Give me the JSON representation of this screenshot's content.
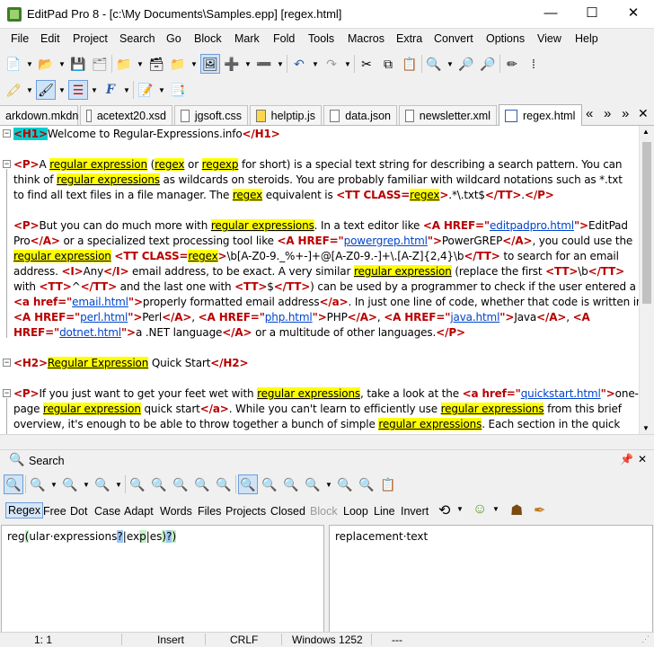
{
  "window": {
    "title": "EditPad Pro 8 - [c:\\My Documents\\Samples.epp] [regex.html]",
    "minimize": "—",
    "maximize": "☐",
    "close": "✕"
  },
  "menu": [
    "File",
    "Edit",
    "Project",
    "Search",
    "Go",
    "Block",
    "Mark",
    "Fold",
    "Tools",
    "Macros",
    "Extra",
    "Convert",
    "Options",
    "View",
    "Help"
  ],
  "tabs": [
    {
      "label": "arkdown.mkdn",
      "icon": "doc-icon"
    },
    {
      "label": "acetext20.xsd",
      "icon": "doc-icon"
    },
    {
      "label": "jgsoft.css",
      "icon": "css-icon"
    },
    {
      "label": "helptip.js",
      "icon": "js-icon"
    },
    {
      "label": "data.json",
      "icon": "doc-icon"
    },
    {
      "label": "newsletter.xml",
      "icon": "xml-icon"
    },
    {
      "label": "regex.html",
      "icon": "html-icon",
      "active": true
    }
  ],
  "tab_controls": [
    "«",
    "»",
    "»",
    "✕"
  ],
  "editor": {
    "l1_open": "<H1>",
    "l1_text": "Welcome to Regular-Expressions.info",
    "l1_close": "</H1>",
    "p1": {
      "a": "<P>",
      "b": "A ",
      "c": "regular expression",
      "d": " (",
      "e": "regex",
      "f": " or ",
      "g": "regexp",
      "h": " for short) is a special text string for describing a search pattern.  You can",
      "i": "think of ",
      "j": "regular expressions",
      "k": " as wildcards on steroids.  You are probably familiar with wildcard notations such as *.txt",
      "l": "to find all text files in a file manager.  The ",
      "m": "regex",
      "n": " equivalent is ",
      "o": "<TT CLASS=",
      "p": "regex",
      "q": ">",
      "r": ".*\\.txt$",
      "s": "</TT>",
      "t": ".",
      "u": "</P>"
    },
    "p2": [
      "<P>",
      "But you can do much more with ",
      "regular expressions",
      ".  In a text editor like ",
      "<A HREF=\"",
      "editpadpro.html",
      "\">",
      "EditPad",
      "Pro",
      "</A>",
      " or a specialized text processing tool like ",
      "<A HREF=\"",
      "powergrep.html",
      "\">",
      "PowerGREP",
      "</A>",
      ", you could use the",
      "regular expression",
      " ",
      "<TT CLASS=",
      "regex",
      ">",
      "\\b[A-Z0-9._%+-]+@[A-Z0-9.-]+\\.[A-Z]{2,4}\\b",
      "</TT>",
      " to search for an email",
      "address.  ",
      "<I>",
      "Any",
      "</I>",
      " email address, to be exact.  A very similar ",
      "regular expression",
      " (replace the first ",
      "<TT>",
      "\\b",
      "</TT>",
      "with ",
      "<TT>",
      "^",
      "</TT>",
      " and the last one with ",
      "<TT>",
      "$",
      "</TT>",
      ") can be used by a programmer to check if the user entered a",
      "<a href=\"",
      "email.html",
      "\">",
      "properly formatted email address",
      "</a>",
      ".  In just one line of code, whether that code is written in",
      "<A HREF=\"",
      "perl.html",
      "\">",
      "Perl",
      "</A>",
      ", ",
      "<A HREF=\"",
      "php.html",
      "\">",
      "PHP",
      "</A>",
      ", ",
      "<A HREF=\"",
      "java.html",
      "\">",
      "Java",
      "</A>",
      ", ",
      "<A",
      "HREF=\"",
      "dotnet.html",
      "\">",
      "a .NET language",
      "</A>",
      " or a multitude of other languages.",
      "</P>"
    ],
    "h2": [
      "<H2>",
      "Regular Expression",
      " Quick Start",
      "</H2>"
    ],
    "p3": [
      "<P>",
      "If you just want to get your feet wet with ",
      "regular expressions",
      ", take a look at the ",
      "<a href=\"",
      "quickstart.html",
      "\">",
      "one-",
      "page ",
      "regular expression",
      " quick start",
      "</a>",
      ".  While you can't learn to efficiently use ",
      "regular expressions",
      " from this brief",
      "overview, it's enough to be able to throw together a bunch of simple ",
      "regular expressions",
      ".  Each section in the quick"
    ]
  },
  "search_panel": {
    "title": "Search",
    "options": [
      {
        "label": "Regex",
        "state": "on"
      },
      {
        "label": "Free",
        "state": "normal"
      },
      {
        "label": "Dot",
        "state": "normal"
      },
      {
        "label": "Case",
        "state": "normal"
      },
      {
        "label": "Adapt",
        "state": "normal"
      },
      {
        "label": "Words",
        "state": "normal"
      },
      {
        "label": "Files",
        "state": "normal"
      },
      {
        "label": "Projects",
        "state": "normal"
      },
      {
        "label": "Closed",
        "state": "normal"
      },
      {
        "label": "Block",
        "state": "disabled"
      },
      {
        "label": "Loop",
        "state": "normal"
      },
      {
        "label": "Line",
        "state": "normal"
      },
      {
        "label": "Invert",
        "state": "normal"
      }
    ],
    "search_text": [
      "reg",
      "(",
      "ular·expressions",
      "?",
      "|",
      "ex",
      "p",
      "|",
      "es",
      ")",
      "?",
      ")"
    ],
    "replace_text": "replacement·text"
  },
  "status": {
    "position": "1: 1",
    "mode": "Insert",
    "linebreak": "CRLF",
    "encoding": "Windows 1252",
    "extra": "---"
  },
  "colors": {
    "tag": "#b80000",
    "link": "#0044cc",
    "highlight": "#ffff00",
    "cursor": "#00cdcd"
  }
}
